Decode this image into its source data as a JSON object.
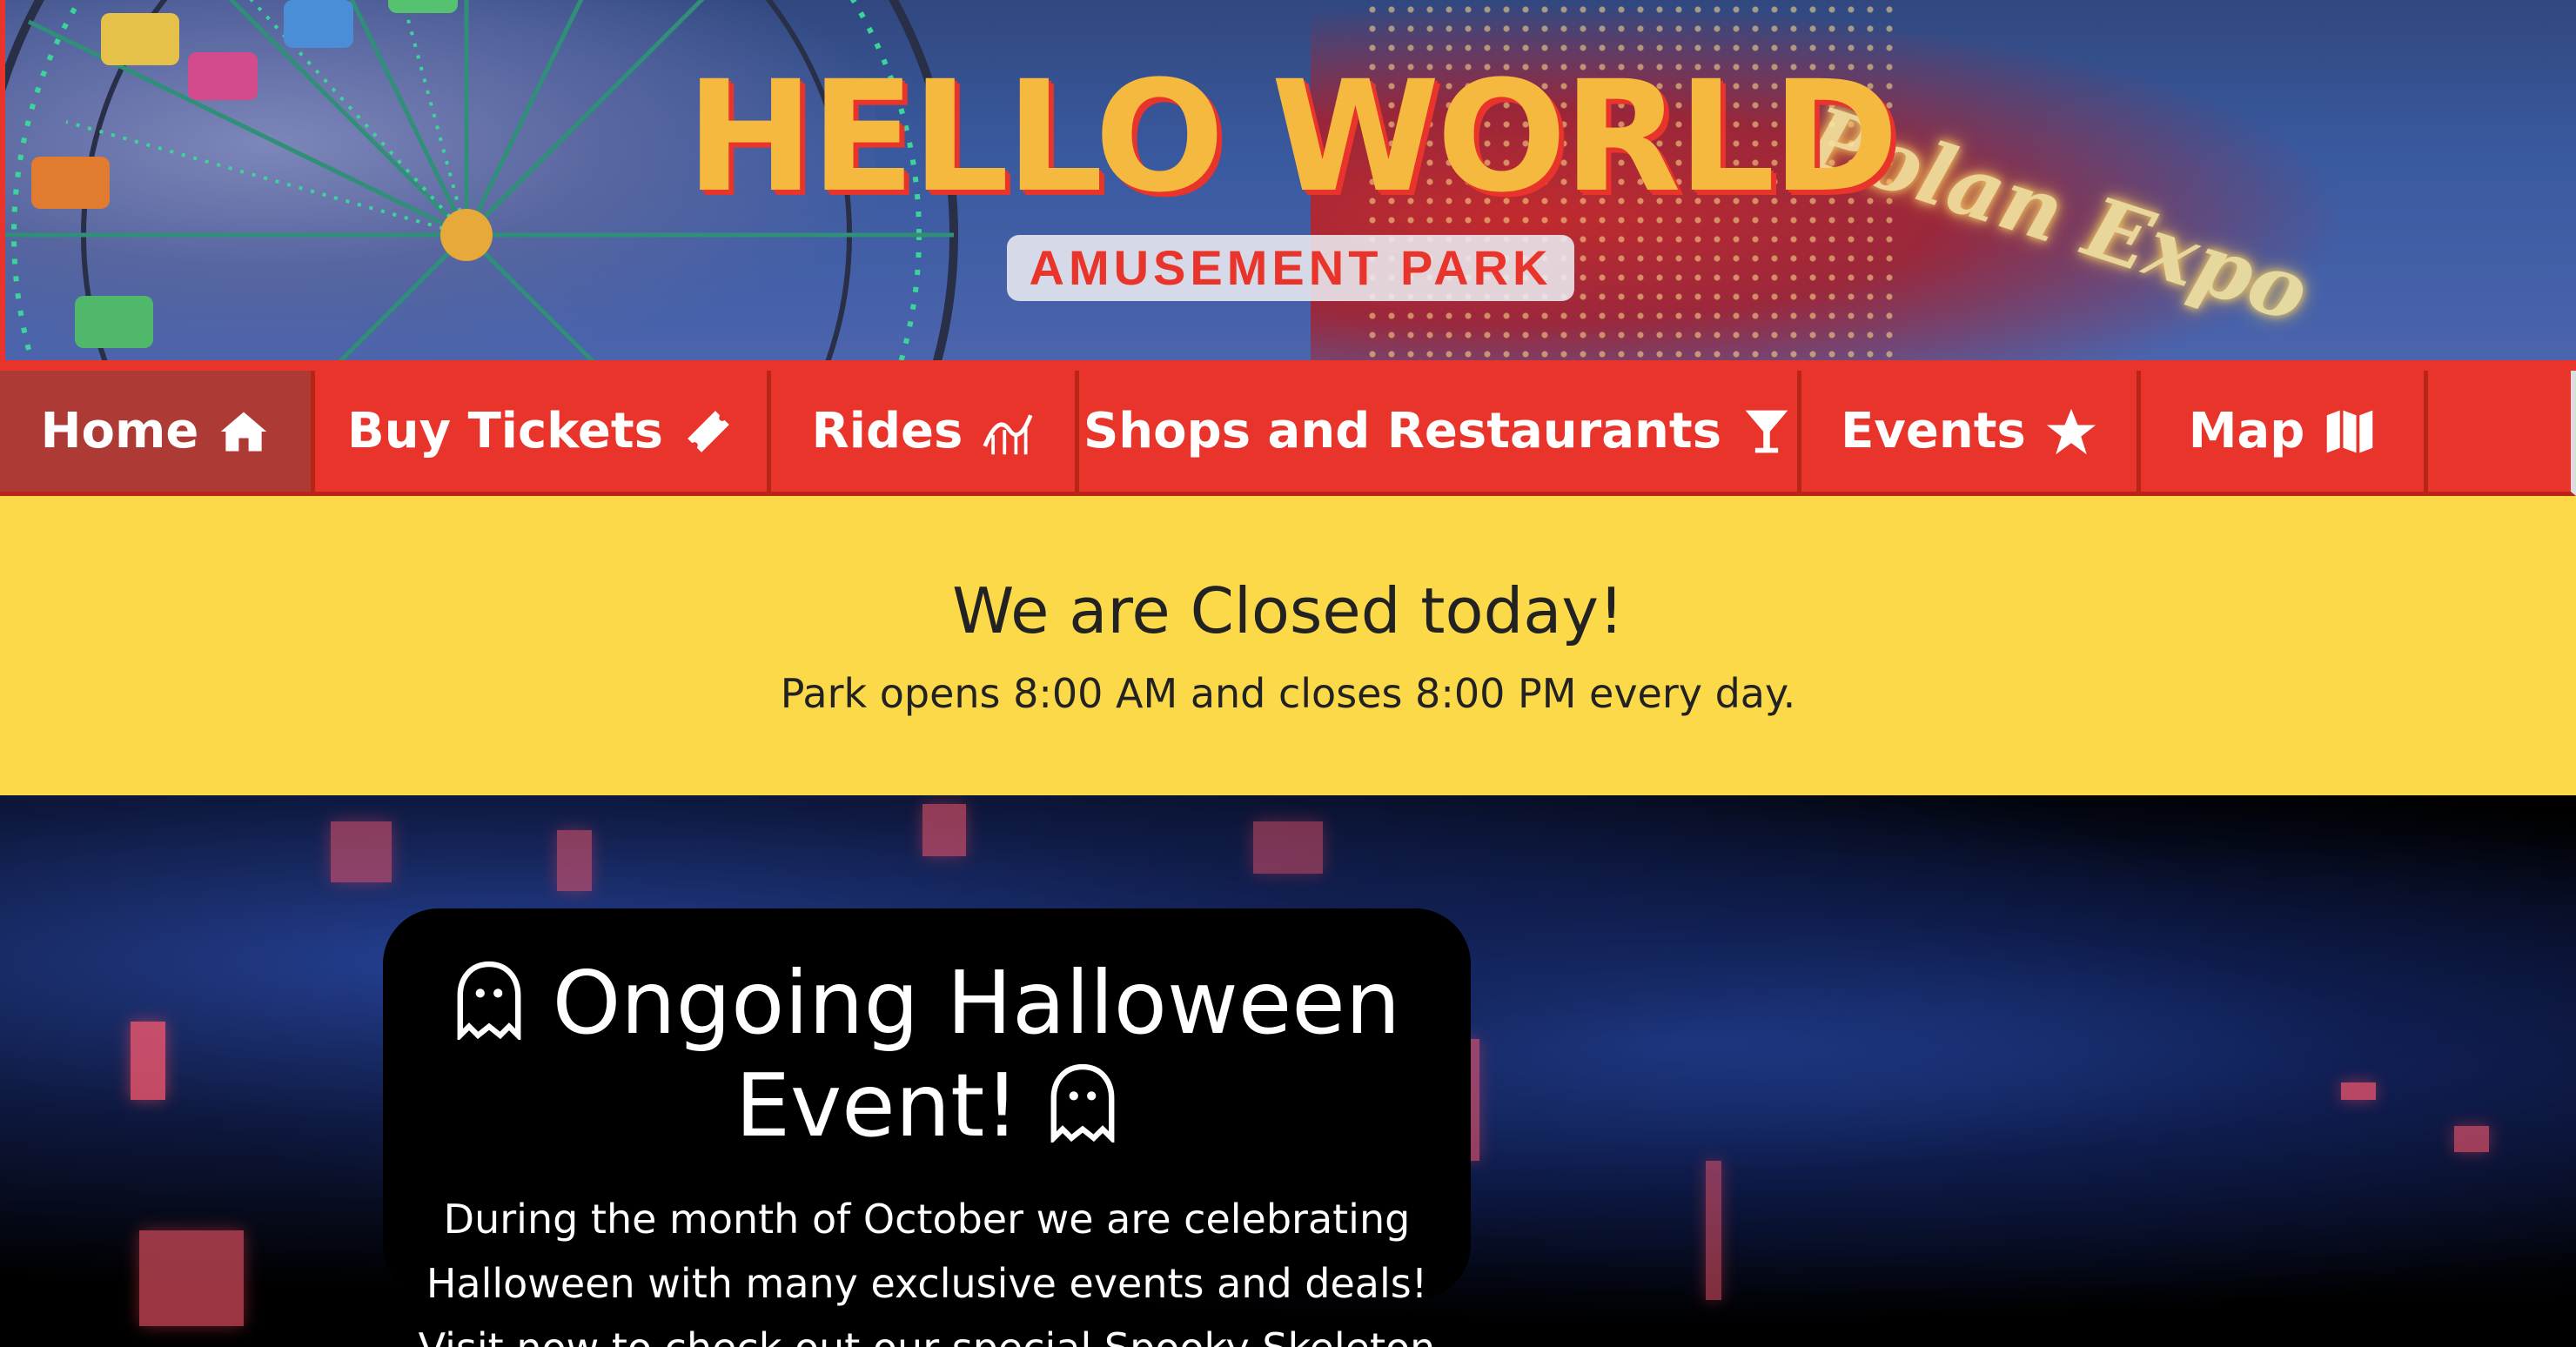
{
  "header": {
    "logo_title": "HELLO WORLD",
    "logo_subtitle": "AMUSEMENT PARK",
    "background_sign_text": "Polan Expo"
  },
  "nav": {
    "items": [
      {
        "label": "Home",
        "icon": "home-icon",
        "active": true
      },
      {
        "label": "Buy Tickets",
        "icon": "ticket-icon",
        "active": false
      },
      {
        "label": "Rides",
        "icon": "roller-coaster-icon",
        "active": false
      },
      {
        "label": "Shops and Restaurants",
        "icon": "cocktail-glass-icon",
        "active": false
      },
      {
        "label": "Events",
        "icon": "star-icon",
        "active": false
      },
      {
        "label": "Map",
        "icon": "map-icon",
        "active": false
      }
    ]
  },
  "notice": {
    "title": "We are Closed today!",
    "hours": "Park opens 8:00 AM and closes 8:00 PM every day."
  },
  "event": {
    "title_line1": "Ongoing Halloween",
    "title_line2": "Event!",
    "icon": "ghost-icon",
    "line1": "During the month of October we are celebrating",
    "line2": "Halloween with many exclusive events and deals!",
    "line3": "Visit now to check out our special Spooky Skeleton"
  },
  "colors": {
    "brand_red": "#e8342a",
    "active_nav": "#ad3a35",
    "logo_yellow": "#f5b93f",
    "notice_yellow": "#fbd949"
  }
}
